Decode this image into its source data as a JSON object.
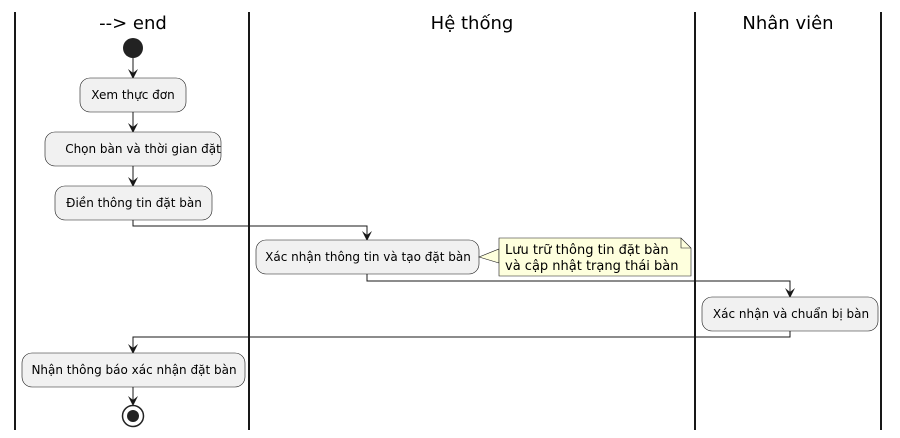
{
  "swimlanes": [
    {
      "title": "--> end"
    },
    {
      "title": "Hệ thống"
    },
    {
      "title": "Nhân viên"
    }
  ],
  "activities": [
    {
      "label": "Xem thực đơn"
    },
    {
      "label": "Chọn bàn và thời gian đặt"
    },
    {
      "label": "Điền thông tin đặt bàn"
    },
    {
      "label": "Xác nhận thông tin và tạo đặt bàn"
    },
    {
      "label": "Xác nhận và chuẩn bị bàn"
    },
    {
      "label": "Nhận thông báo xác nhận đặt bàn"
    }
  ],
  "note": {
    "line1": "Lưu trữ thông tin đặt bàn",
    "line2": "và cập nhật trạng thái bàn"
  },
  "colors": {
    "activity_fill": "#f1f1f1",
    "activity_stroke": "#181818",
    "note_fill": "#feffdd",
    "line": "#181818"
  }
}
